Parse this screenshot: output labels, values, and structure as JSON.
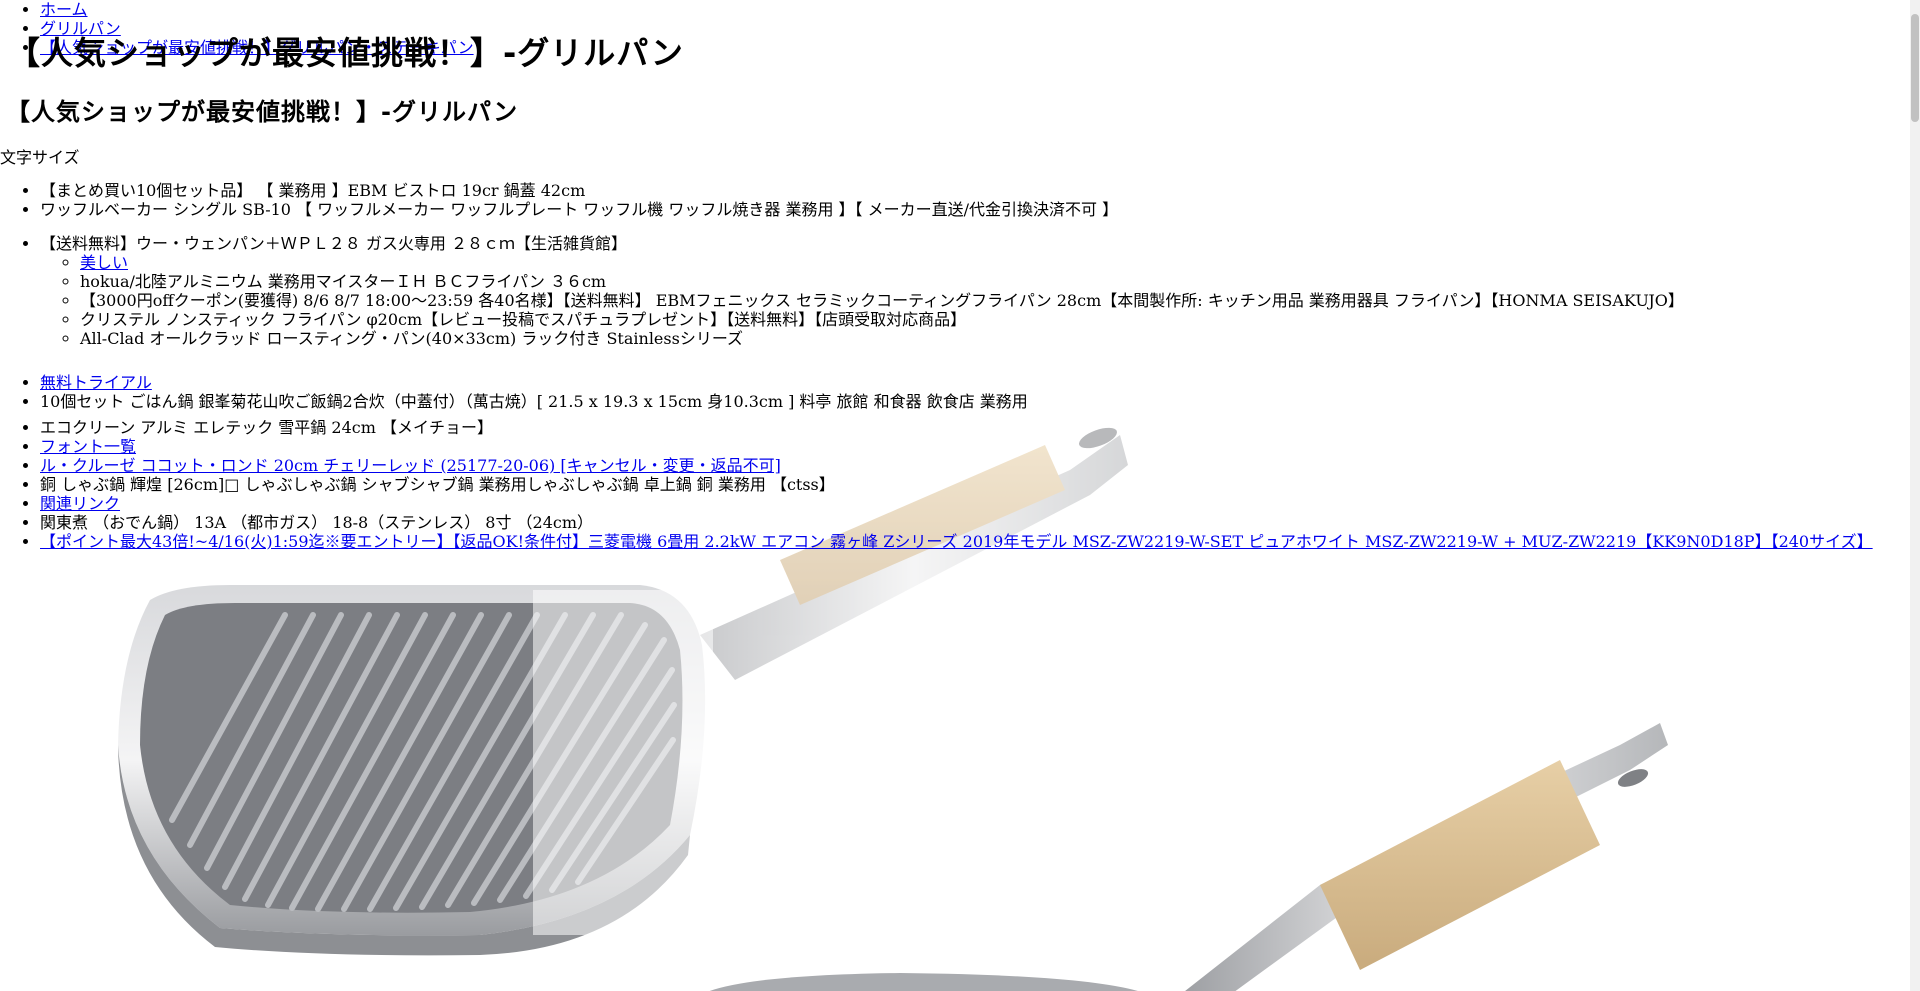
{
  "breadcrumb": [
    {
      "label": "ホーム"
    },
    {
      "label": "グリルパン"
    },
    {
      "label": "【人気ショップが最安値挑戦！】グリルパン・ステーキパン"
    }
  ],
  "page": {
    "title_overlay": "【人気ショップが最安値挑戦！】-グリルパン",
    "title": "【人気ショップが最安値挑戦！】-グリルパン",
    "font_size_label": "文字サイズ"
  },
  "list1": [
    "【まとめ買い10個セット品】 【 業務用 】EBM ビストロ 19cr 鍋蓋 42cm",
    "ワッフルベーカー シングル SB-10 【 ワッフルメーカー ワッフルプレート ワッフル機 ワッフル焼き器 業務用 】【 メーカー直送/代金引換決済不可 】"
  ],
  "list2": {
    "item": "【送料無料】ウー・ウェンパン＋ＷＰＬ２８ ガス火専用 ２８ｃｍ【生活雑貨館】",
    "sub": [
      {
        "label": "美しい",
        "link": true
      },
      {
        "label": "hokua/北陸アルミニウム 業務用マイスターＩＨ ＢＣフライパン ３６cm",
        "link": false
      },
      {
        "label": "【3000円offクーポン(要獲得) 8/6 8/7 18:00～23:59 各40名様】【送料無料】 EBMフェニックス セラミックコーティングフライパン 28cm【本間製作所: キッチン用品 業務用器具 フライパン】【HONMA SEISAKUJO】",
        "link": false
      },
      {
        "label": "クリステル ノンスティック フライパン φ20cm【レビュー投稿でスパチュラプレゼント】【送料無料】【店頭受取対応商品】",
        "link": false
      },
      {
        "label": "All-Clad オールクラッド ロースティング・パン(40×33cm) ラック付き Stainlessシリーズ",
        "link": false
      }
    ]
  },
  "list3": [
    {
      "label": "無料トライアル",
      "link": true
    },
    {
      "label": "10個セット ごはん鍋 銀峯菊花山吹ご飯鍋2合炊（中蓋付）（萬古焼）[ 21.5 x 19.3 x 15cm 身10.3cm ] 料亭 旅館 和食器 飲食店 業務用",
      "link": false
    }
  ],
  "list4": [
    {
      "label": "エコクリーン アルミ エレテック 雪平鍋 24cm 【メイチョー】",
      "link": false
    },
    {
      "label": "フォント一覧",
      "link": true
    },
    {
      "label": "ル・クルーゼ ココット・ロンド 20cm チェリーレッド (25177-20-06) [キャンセル・変更・返品不可]",
      "link": true
    },
    {
      "label": "銅 しゃぶ鍋 輝煌 [26cm]□ しゃぶしゃぶ鍋 シャブシャブ鍋 業務用しゃぶしゃぶ鍋 卓上鍋 銅 業務用 【ctss】",
      "link": false
    },
    {
      "label": "関連リンク",
      "link": true
    },
    {
      "label": "関東煮 （おでん鍋） 13A （都市ガス） 18-8（ステンレス） 8寸 （24cm）",
      "link": false
    },
    {
      "label": "【ポイント最大43倍!~4/16(火)1:59迄※要エントリー】【返品OK!条件付】三菱電機 6畳用 2.2kW エアコン 霧ヶ峰 Zシリーズ 2019年モデル MSZ-ZW2219-W-SET ピュアホワイト MSZ-ZW2219-W + MUZ-ZW2219【KK9N0D18P】【240サイズ】",
      "link": true
    }
  ]
}
